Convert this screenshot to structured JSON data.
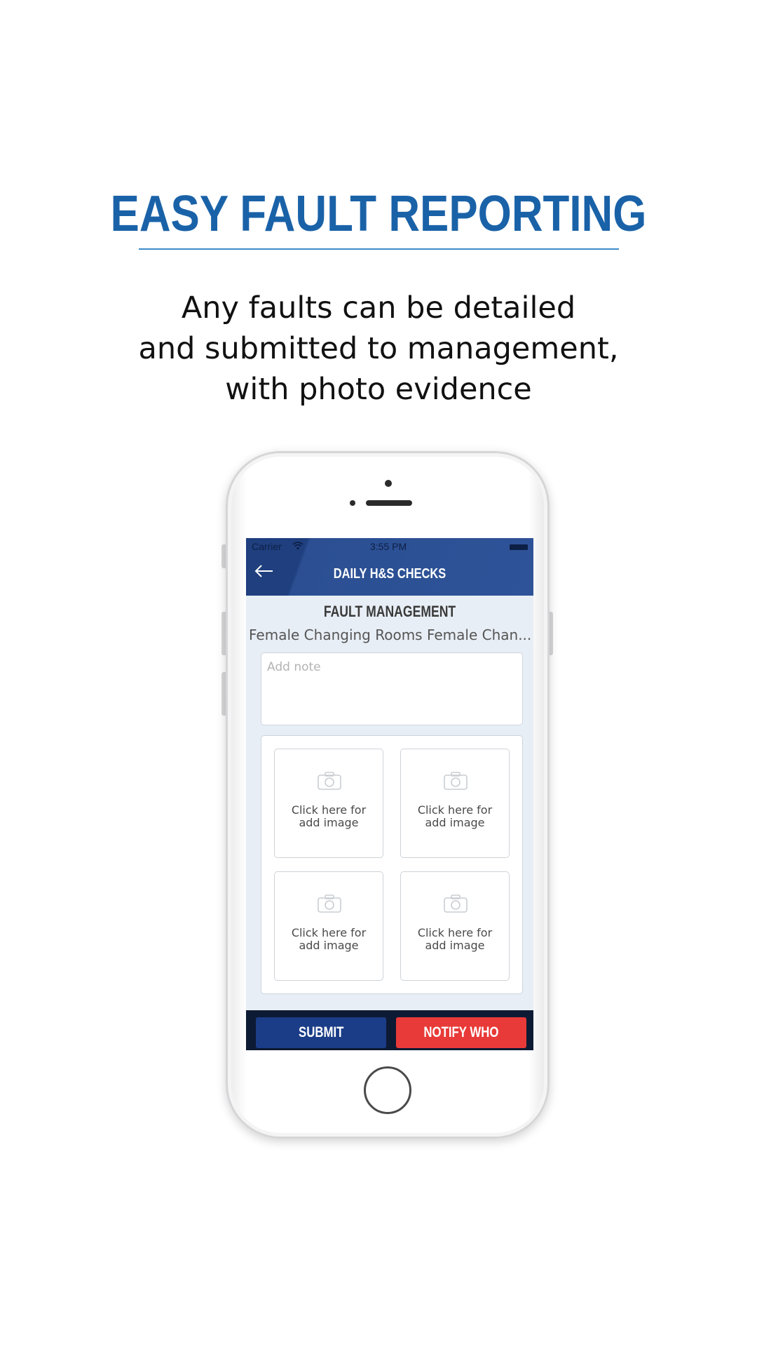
{
  "headline": "EASY FAULT REPORTING",
  "subtitle": {
    "lines": [
      "Any faults can be detailed",
      "and submitted to management,",
      "with photo evidence"
    ]
  },
  "phone": {
    "status_bar": {
      "carrier": "Carrier",
      "time": "3:55 PM"
    },
    "header": {
      "title": "DAILY H&S CHECKS"
    },
    "section_title": "FAULT MANAGEMENT",
    "location": "Female Changing Rooms Female Chan...",
    "note": {
      "value": "",
      "placeholder": "Add note"
    },
    "image_slots": [
      {
        "line1": "Click here for",
        "line2": "add image"
      },
      {
        "line1": "Click here for",
        "line2": "add image"
      },
      {
        "line1": "Click here for",
        "line2": "add image"
      },
      {
        "line1": "Click here for",
        "line2": "add image"
      }
    ],
    "buttons": {
      "submit": "SUBMIT",
      "notify": "NOTIFY WHO"
    },
    "colors": {
      "header": "#2e5398",
      "submit": "#1b3d88",
      "notify": "#e83a38",
      "headline": "#1a62a8"
    }
  }
}
